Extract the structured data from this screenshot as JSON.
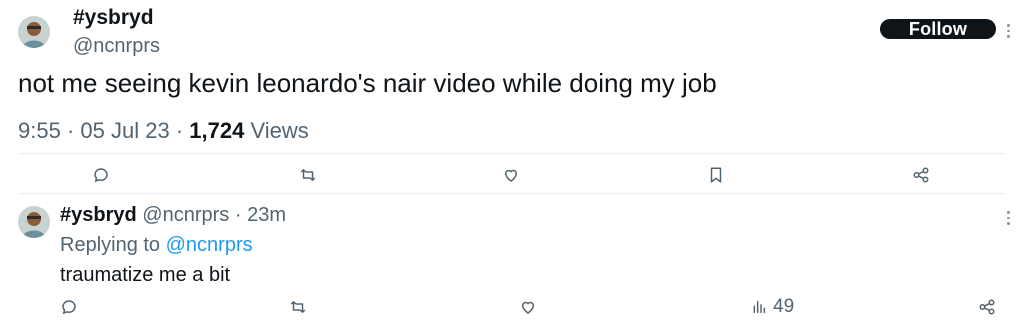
{
  "main_tweet": {
    "display_name": "#ysbryd",
    "handle": "@ncnrprs",
    "follow_label": "Follow",
    "text": "not me seeing kevin leonardo's nair video while doing my job",
    "time": "9:55",
    "sep1": "·",
    "date": "05 Jul 23",
    "sep2": "·",
    "views_count": "1,724",
    "views_label": "Views"
  },
  "actions": [
    "reply-icon",
    "retweet-icon",
    "like-icon",
    "bookmark-icon",
    "share-icon"
  ],
  "reply": {
    "display_name": "#ysbryd",
    "handle": "@ncnrprs",
    "sep": "·",
    "time_ago": "23m",
    "replying_prefix": "Replying to",
    "replying_handle": "@ncnrprs",
    "text": "traumatize me a bit",
    "views": "49"
  },
  "colors": {
    "text": "#0f1419",
    "muted": "#536471",
    "link": "#1d9bf0",
    "button": "#0f1419"
  }
}
